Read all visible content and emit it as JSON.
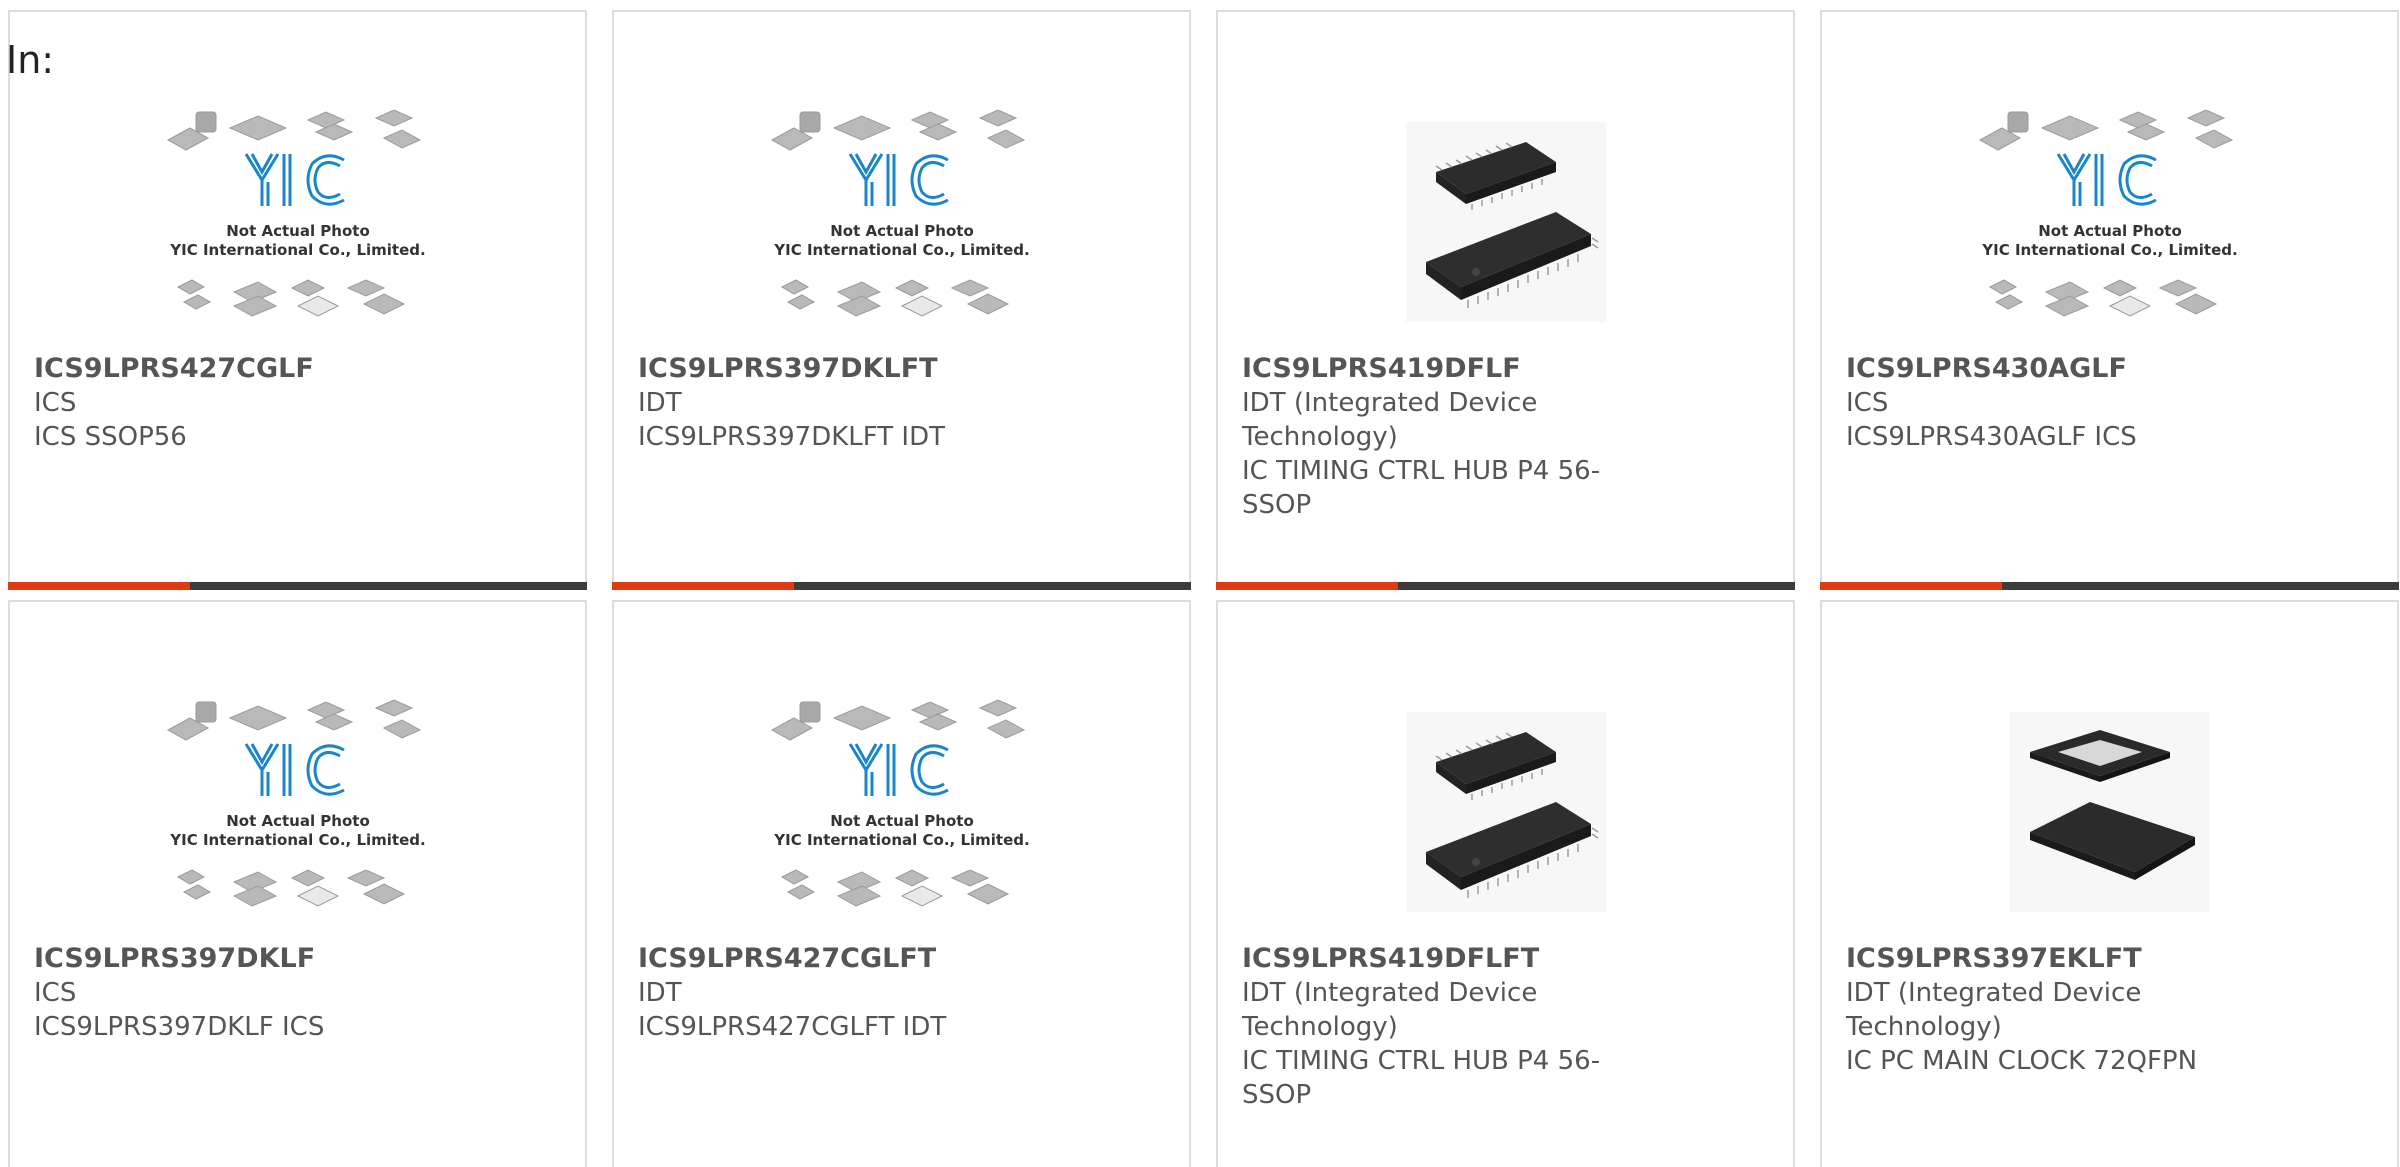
{
  "header": {
    "in_label": "In:"
  },
  "placeholder": {
    "line1": "Not Actual Photo",
    "line2": "YIC International Co., Limited.",
    "logo_text": "YIC"
  },
  "products": [
    {
      "part": "ICS9LPRS427CGLF",
      "mfr": "ICS",
      "desc": "ICS SSOP56",
      "image": "placeholder"
    },
    {
      "part": "ICS9LPRS397DKLFT",
      "mfr": "IDT",
      "desc": "ICS9LPRS397DKLFT IDT",
      "image": "placeholder"
    },
    {
      "part": "ICS9LPRS419DFLF",
      "mfr": "IDT (Integrated Device Technology)",
      "desc": "IC TIMING CTRL HUB P4 56-SSOP",
      "image": "ssop-photo"
    },
    {
      "part": "ICS9LPRS430AGLF",
      "mfr": "ICS",
      "desc": "ICS9LPRS430AGLF ICS",
      "image": "placeholder"
    },
    {
      "part": "ICS9LPRS397DKLF",
      "mfr": "ICS",
      "desc": "ICS9LPRS397DKLF ICS",
      "image": "placeholder"
    },
    {
      "part": "ICS9LPRS427CGLFT",
      "mfr": "IDT",
      "desc": "ICS9LPRS427CGLFT IDT",
      "image": "placeholder"
    },
    {
      "part": "ICS9LPRS419DFLFT",
      "mfr": "IDT (Integrated Device Technology)",
      "desc": "IC TIMING CTRL HUB P4 56-SSOP",
      "image": "ssop-photo"
    },
    {
      "part": "ICS9LPRS397EKLFT",
      "mfr": "IDT (Integrated Device Technology)",
      "desc": "IC PC MAIN CLOCK 72QFPN",
      "image": "qfn-photo"
    }
  ],
  "colors": {
    "accent": "#e03a10",
    "bar": "#3c3c3c",
    "border": "#dcdcdc",
    "text": "#555555",
    "logo_blue": "#1a86c8"
  }
}
